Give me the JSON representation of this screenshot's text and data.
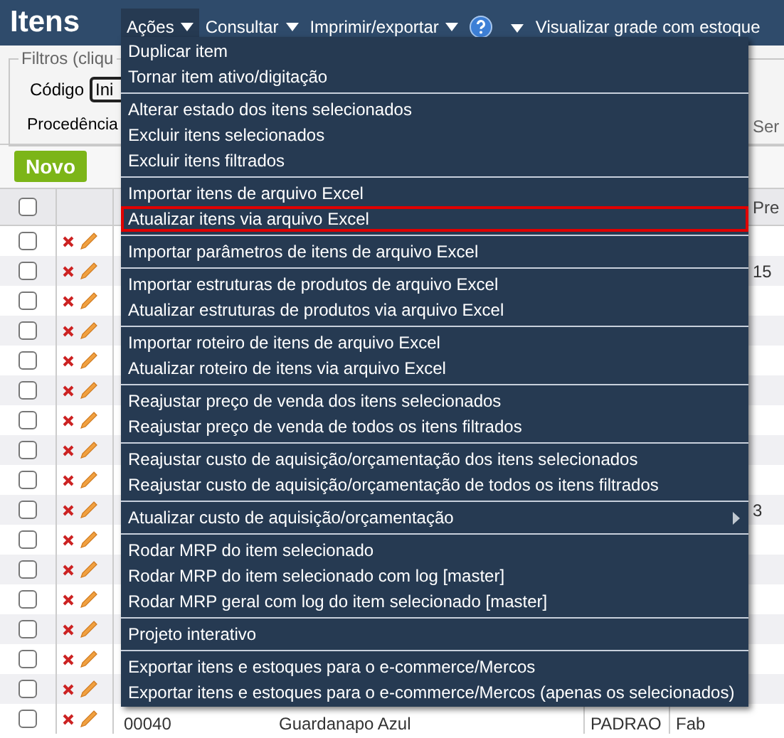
{
  "header": {
    "title": "Itens",
    "menu": [
      {
        "kind": "dropdown",
        "label": "Ações",
        "selected": true
      },
      {
        "kind": "dropdown",
        "label": "Consultar",
        "selected": false
      },
      {
        "kind": "dropdown",
        "label": "Imprimir/exportar",
        "selected": false
      },
      {
        "kind": "help",
        "selected": false
      },
      {
        "kind": "link",
        "label": "Visualizar grade com estoque",
        "selected": false
      }
    ]
  },
  "filters": {
    "legend": "Filtros (cliqu",
    "code_label": "Código",
    "code_value": "Ini",
    "origin_label": "Procedência",
    "right_label": "Ser"
  },
  "toolbar": {
    "new_button": "Novo"
  },
  "table": {
    "header_checked": false,
    "price_header": "Pre",
    "rows": [
      {
        "checked": false
      },
      {
        "checked": false,
        "price": "15"
      },
      {
        "checked": false
      },
      {
        "checked": false
      },
      {
        "checked": false
      },
      {
        "checked": false
      },
      {
        "checked": false
      },
      {
        "checked": false
      },
      {
        "checked": false
      },
      {
        "checked": false,
        "price": "3"
      },
      {
        "checked": false
      },
      {
        "checked": false
      },
      {
        "checked": false
      },
      {
        "checked": false
      },
      {
        "checked": false
      },
      {
        "checked": false
      },
      {
        "checked": false,
        "code": "00040",
        "description": "Guardanapo Azul",
        "column_5": "PADRAO",
        "column_6": "Fab"
      }
    ]
  },
  "actions_menu": {
    "groups": [
      [
        {
          "label": "Duplicar item",
          "highlighted": false
        },
        {
          "label": "Tornar item ativo/digitação",
          "highlighted": false
        }
      ],
      [
        {
          "label": "Alterar estado dos itens selecionados",
          "highlighted": false
        },
        {
          "label": "Excluir itens selecionados",
          "highlighted": false
        },
        {
          "label": "Excluir itens filtrados",
          "highlighted": false
        }
      ],
      [
        {
          "label": "Importar itens de arquivo Excel",
          "highlighted": false
        },
        {
          "label": "Atualizar itens via arquivo Excel",
          "highlighted": true
        }
      ],
      [
        {
          "label": "Importar parâmetros de itens de arquivo Excel",
          "highlighted": false
        }
      ],
      [
        {
          "label": "Importar estruturas de produtos de arquivo Excel",
          "highlighted": false
        },
        {
          "label": "Atualizar estruturas de produtos via arquivo Excel",
          "highlighted": false
        }
      ],
      [
        {
          "label": "Importar roteiro de itens de arquivo Excel",
          "highlighted": false
        },
        {
          "label": "Atualizar roteiro de itens via arquivo Excel",
          "highlighted": false
        }
      ],
      [
        {
          "label": "Reajustar preço de venda dos itens selecionados",
          "highlighted": false
        },
        {
          "label": "Reajustar preço de venda de todos os itens filtrados",
          "highlighted": false
        }
      ],
      [
        {
          "label": "Reajustar custo de aquisição/orçamentação dos itens selecionados",
          "highlighted": false
        },
        {
          "label": "Reajustar custo de aquisição/orçamentação de todos os itens filtrados",
          "highlighted": false
        }
      ],
      [
        {
          "label": "Atualizar custo de aquisição/orçamentação",
          "highlighted": false,
          "submenu": true
        }
      ],
      [
        {
          "label": "Rodar MRP do item selecionado",
          "highlighted": false
        },
        {
          "label": "Rodar MRP do item selecionado com log [master]",
          "highlighted": false
        },
        {
          "label": "Rodar MRP geral com log do item selecionado [master]",
          "highlighted": false
        }
      ],
      [
        {
          "label": "Projeto interativo",
          "highlighted": false
        }
      ],
      [
        {
          "label": "Exportar itens e estoques para o e-commerce/Mercos",
          "highlighted": false
        },
        {
          "label": "Exportar itens e estoques para o e-commerce/Mercos (apenas os selecionados)",
          "highlighted": false
        }
      ]
    ]
  }
}
